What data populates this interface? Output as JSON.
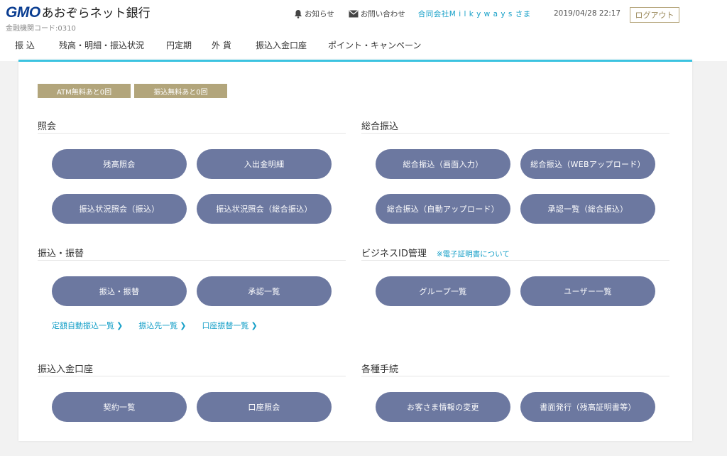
{
  "brand": {
    "logo_mark": "GMO",
    "logo_name": "あおぞらネット銀行"
  },
  "bank_code": "金融機関コード:0310",
  "header": {
    "notice": "お知らせ",
    "contact": "お問い合わせ",
    "company": "合同会社M i l k y w a y s さま",
    "datetime": "2019/04/28 22:17",
    "logout": "ログアウト"
  },
  "nav": [
    "振 込",
    "残高・明細・振込状況",
    "円定期",
    "外 貨",
    "振込入金口座",
    "ポイント・キャンペーン"
  ],
  "badges": [
    "ATM無料あと0回",
    "振込無料あと0回"
  ],
  "sections": {
    "inquiry": {
      "title": "照会",
      "buttons": [
        "残高照会",
        "入出金明細",
        "振込状況照会（振込）",
        "振込状況照会（総合振込）"
      ]
    },
    "bulk_transfer": {
      "title": "総合振込",
      "buttons": [
        "総合振込（画面入力）",
        "総合振込（WEBアップロード）",
        "総合振込（自動アップロード）",
        "承認一覧（総合振込）"
      ]
    },
    "transfer": {
      "title": "振込・振替",
      "buttons": [
        "振込・振替",
        "承認一覧"
      ],
      "links": [
        "定額自動振込一覧",
        "振込先一覧",
        "口座振替一覧"
      ]
    },
    "business_id": {
      "title": "ビジネスID管理",
      "link": "※電子証明書について",
      "buttons": [
        "グループ一覧",
        "ユーザー一覧"
      ]
    },
    "deposit_account": {
      "title": "振込入金口座",
      "buttons": [
        "契約一覧",
        "口座照会"
      ]
    },
    "procedures": {
      "title": "各種手続",
      "buttons": [
        "お客さま情報の変更",
        "書面発行（残高証明書等）"
      ]
    }
  },
  "colors": {
    "brand": "#0a3d91",
    "accent": "#3cc3e0",
    "link": "#17a0c8",
    "button": "#6c78a0",
    "badge": "#b2a57b"
  }
}
